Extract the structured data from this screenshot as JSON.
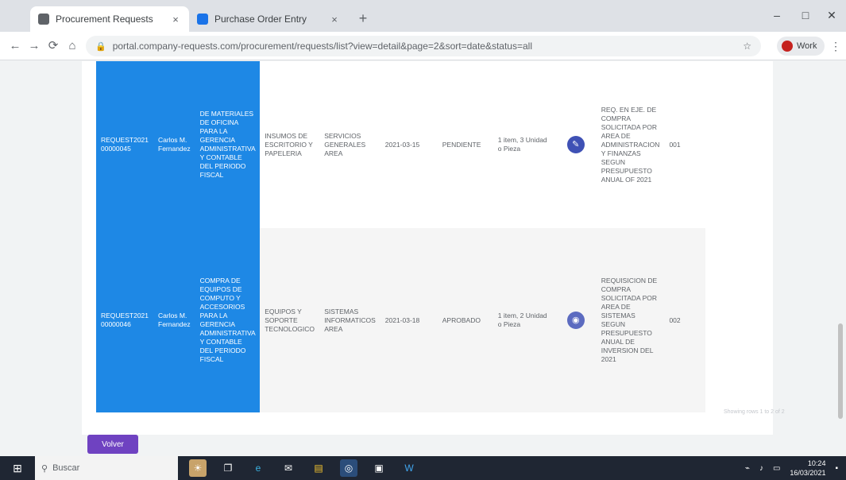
{
  "browser": {
    "tabs": [
      {
        "title": "Procurement Requests",
        "close": "×"
      },
      {
        "title": "Purchase Order Entry",
        "close": "×"
      }
    ],
    "new_tab": "+",
    "window_controls": [
      "–",
      "□",
      "✕"
    ],
    "nav": {
      "back": "←",
      "forward": "→",
      "reload": "⟳",
      "home": "⌂"
    },
    "url": "portal.company-requests.com/procurement/requests/list?view=detail&page=2&sort=date&status=all",
    "profile_label": "Work"
  },
  "table": {
    "rows": [
      {
        "code": "REQUEST2021 00000045",
        "name": "Carlos M. Fernandez",
        "description": "DE MATERIALES DE OFICINA PARA LA GERENCIA ADMINISTRATIVA Y CONTABLE DEL PERIODO FISCAL",
        "col_a": "INSUMOS DE ESCRITORIO Y PAPELERIA",
        "col_b": "SERVICIOS GENERALES AREA",
        "col_c": "2021-03-15",
        "col_d": "PENDIENTE",
        "col_e": "1 item, 3 Unidad o Pieza",
        "long_text": "REQ. EN EJE. DE COMPRA SOLICITADA POR AREA DE ADMINISTRACION Y FINANZAS SEGUN PRESUPUESTO ANUAL OF 2021",
        "qty": "001",
        "action_icon": "edit-icon"
      },
      {
        "code": "REQUEST2021 00000046",
        "name": "Carlos M. Fernandez",
        "description": "COMPRA DE EQUIPOS DE COMPUTO Y ACCESORIOS PARA LA GERENCIA ADMINISTRATIVA Y CONTABLE DEL PERIODO FISCAL",
        "col_a": "EQUIPOS Y SOPORTE TECNOLOGICO",
        "col_b": "SISTEMAS INFORMATICOS AREA",
        "col_c": "2021-03-18",
        "col_d": "APROBADO",
        "col_e": "1 item, 2 Unidad o Pieza",
        "long_text": "REQUISICION DE COMPRA SOLICITADA POR AREA DE SISTEMAS SEGUN PRESUPUESTO ANUAL DE INVERSION DEL 2021",
        "qty": "002",
        "action_icon": "view-icon"
      }
    ],
    "footer_hint": "Showing rows 1 to 2 of 2"
  },
  "page": {
    "action_button": "Volver"
  },
  "taskbar": {
    "search_placeholder": "Buscar",
    "time": "10:24",
    "date": "16/03/2021"
  }
}
